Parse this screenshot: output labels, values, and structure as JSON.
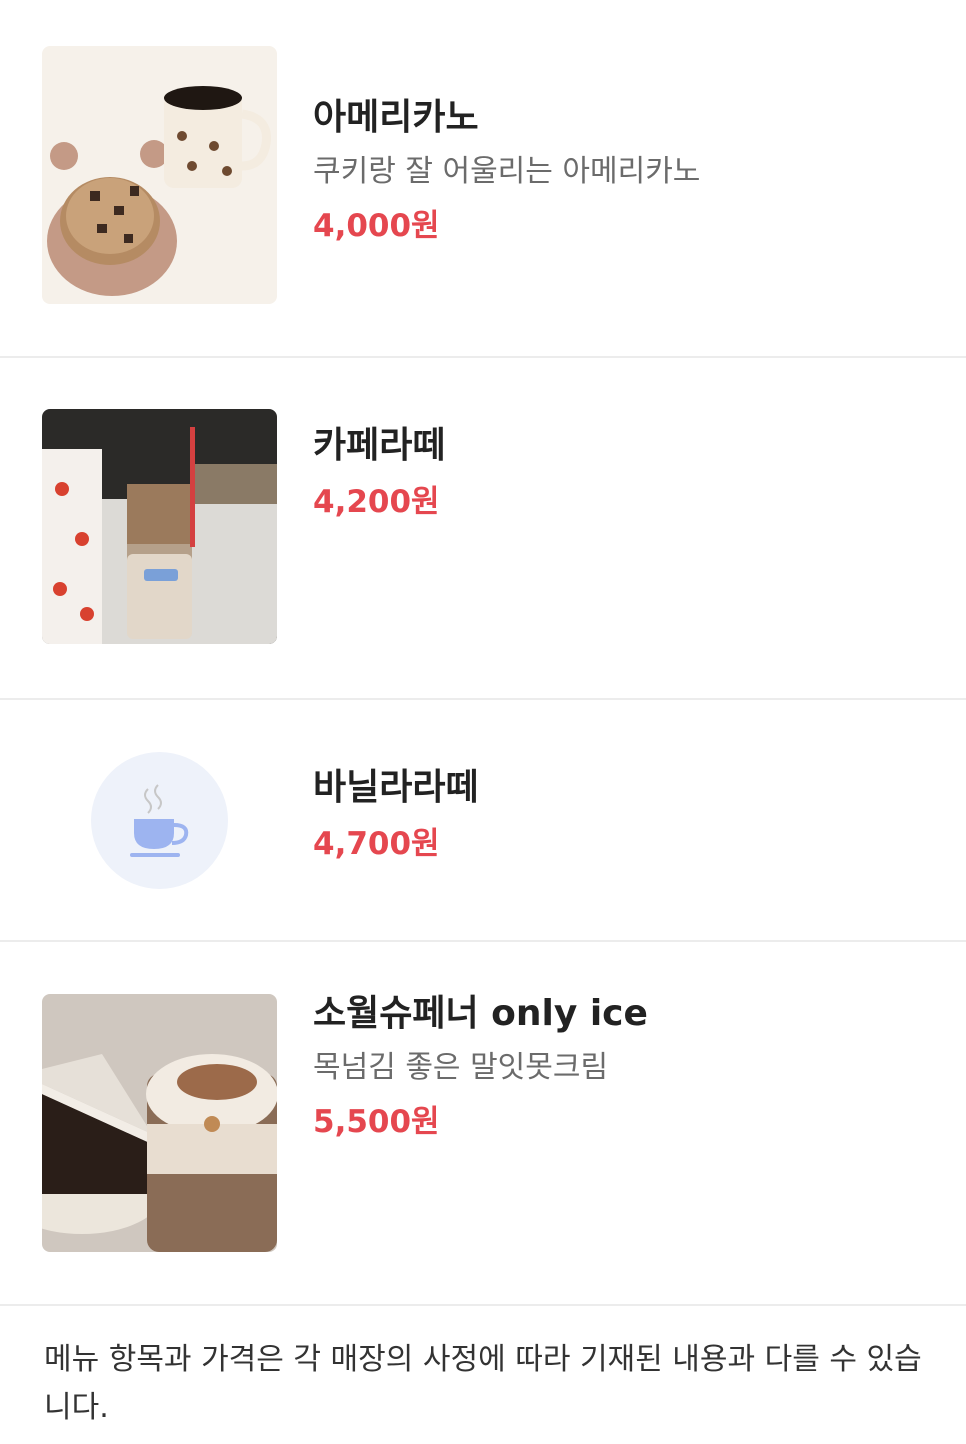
{
  "menu": {
    "items": [
      {
        "name": "아메리카노",
        "description": "쿠키랑 잘 어울리는 아메리카노",
        "price": "4,000원",
        "image": "americano-photo"
      },
      {
        "name": "카페라떼",
        "description": "",
        "price": "4,200원",
        "image": "cafe-latte-photo"
      },
      {
        "name": "바닐라라떼",
        "description": "",
        "price": "4,700원",
        "image": "coffee-cup-icon"
      },
      {
        "name": "소월슈페너 only ice",
        "description": "목넘김 좋은 말잇못크림",
        "price": "5,500원",
        "image": "einspanner-photo"
      }
    ]
  },
  "notice": "메뉴 항목과 가격은 각 매장의 사정에 따라 기재된 내용과 다를 수 있습니다.",
  "colors": {
    "price": "#e5474f",
    "divider": "#ececec",
    "placeholder_bg": "#eef2fa",
    "icon": "#9db4f0"
  }
}
